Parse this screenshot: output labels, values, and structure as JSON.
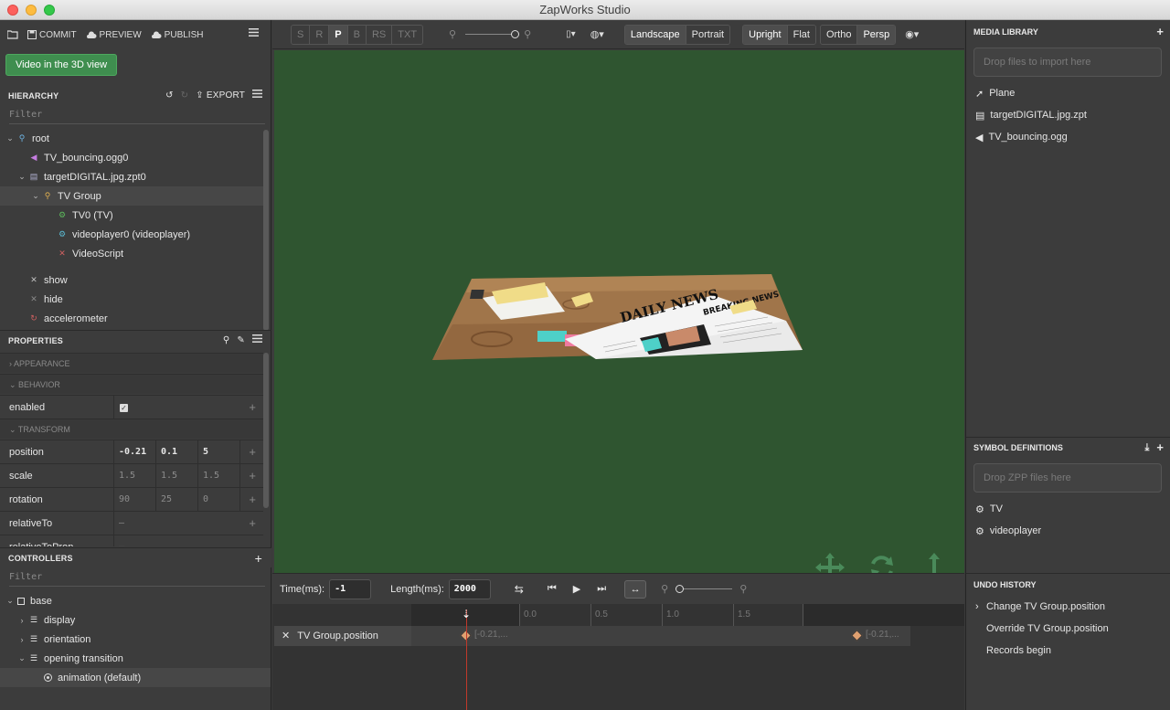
{
  "window": {
    "title": "ZapWorks Studio"
  },
  "topbar": {
    "commit": "COMMIT",
    "preview": "PREVIEW",
    "publish": "PUBLISH"
  },
  "green_button": "Video in the 3D view",
  "hierarchy": {
    "title": "HIERARCHY",
    "export": "EXPORT",
    "filter_placeholder": "Filter",
    "items": [
      {
        "label": "root"
      },
      {
        "label": "TV_bouncing.ogg0"
      },
      {
        "label": "targetDIGITAL.jpg.zpt0"
      },
      {
        "label": "TV Group"
      },
      {
        "label": "TV0 (TV)"
      },
      {
        "label": "videoplayer0 (videoplayer)"
      },
      {
        "label": "VideoScript"
      },
      {
        "label": "show"
      },
      {
        "label": "hide"
      },
      {
        "label": "accelerometer"
      }
    ]
  },
  "properties": {
    "title": "PROPERTIES",
    "sections": {
      "appearance": "APPEARANCE",
      "behavior": "BEHAVIOR",
      "transform": "TRANSFORM"
    },
    "enabled": {
      "label": "enabled",
      "checked": true
    },
    "rows": [
      {
        "name": "position",
        "v": [
          "-0.21",
          "0.1",
          "5"
        ]
      },
      {
        "name": "scale",
        "v": [
          "1.5",
          "1.5",
          "1.5"
        ]
      },
      {
        "name": "rotation",
        "v": [
          "90",
          "25",
          "0"
        ]
      },
      {
        "name": "relativeTo",
        "v": [
          "—"
        ]
      },
      {
        "name": "relativeToProp",
        "v": [
          "—"
        ]
      }
    ]
  },
  "controllers": {
    "title": "CONTROLLERS",
    "filter_placeholder": "Filter",
    "items": [
      {
        "label": "base"
      },
      {
        "label": "display"
      },
      {
        "label": "orientation"
      },
      {
        "label": "opening transition"
      },
      {
        "label": "animation (default)"
      }
    ]
  },
  "toolbar": {
    "modes": [
      "S",
      "R",
      "P",
      "B",
      "RS",
      "TXT"
    ],
    "active_mode": "P",
    "orientation": [
      "Landscape",
      "Portrait"
    ],
    "upright": [
      "Upright",
      "Flat"
    ],
    "projection": [
      "Ortho",
      "Persp"
    ]
  },
  "viewport": {
    "newspaper_title": "DAILY NEWS",
    "newspaper_headline": "BREAKING NEWS"
  },
  "timeline": {
    "time_label": "Time(ms):",
    "time_value": "-1",
    "length_label": "Length(ms):",
    "length_value": "2000",
    "ticks": [
      "0.0",
      "0.5",
      "1.0",
      "1.5"
    ],
    "track": "TV Group.position",
    "key1": "[-0.21,...",
    "key2": "[-0.21,..."
  },
  "media_library": {
    "title": "MEDIA LIBRARY",
    "drop": "Drop files to import here",
    "items": [
      "Plane",
      "targetDIGITAL.jpg.zpt",
      "TV_bouncing.ogg"
    ]
  },
  "symbols": {
    "title": "SYMBOL DEFINITIONS",
    "drop": "Drop ZPP files here",
    "items": [
      "TV",
      "videoplayer"
    ]
  },
  "undo": {
    "title": "UNDO HISTORY",
    "items": [
      "Change TV Group.position",
      "Override TV Group.position",
      "Records begin"
    ]
  },
  "colors": {
    "viewport_bg": "#2f5530",
    "accent_green": "#3f8e4f",
    "playhead": "#c0392b"
  }
}
